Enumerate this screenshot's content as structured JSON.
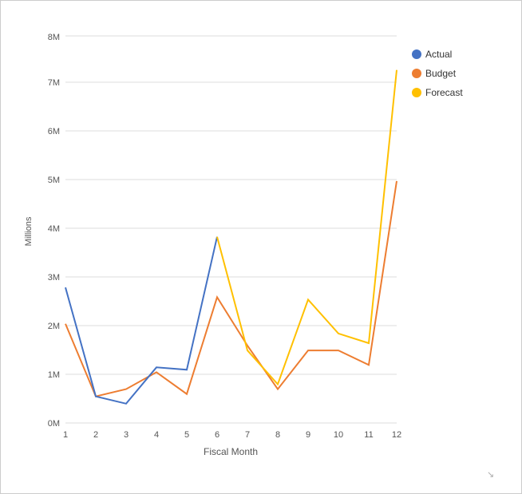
{
  "chart": {
    "title": "",
    "x_axis_label": "Fiscal Month",
    "y_axis_label": "Millions",
    "x_axis_month_label": "Month",
    "y_labels": [
      "0M",
      "1M",
      "2M",
      "3M",
      "4M",
      "5M",
      "6M",
      "7M",
      "8M"
    ],
    "x_labels": [
      "1",
      "2",
      "3",
      "4",
      "5",
      "6",
      "7",
      "8",
      "9",
      "10",
      "11",
      "12"
    ],
    "legend": {
      "actual": {
        "label": "Actual",
        "color": "#4472C4"
      },
      "budget": {
        "label": "Budget",
        "color": "#ED7D31"
      },
      "forecast": {
        "label": "Forecast",
        "color": "#FFC000"
      }
    },
    "series": {
      "actual": [
        2800000,
        550000,
        400000,
        1150000,
        1100000,
        3850000,
        null,
        null,
        null,
        null,
        null,
        null
      ],
      "budget": [
        2050000,
        550000,
        700000,
        1050000,
        600000,
        2600000,
        1600000,
        700000,
        1500000,
        1500000,
        1200000,
        5000000
      ],
      "forecast": [
        null,
        null,
        null,
        null,
        null,
        3850000,
        1500000,
        800000,
        2550000,
        1850000,
        1650000,
        7300000
      ]
    }
  }
}
